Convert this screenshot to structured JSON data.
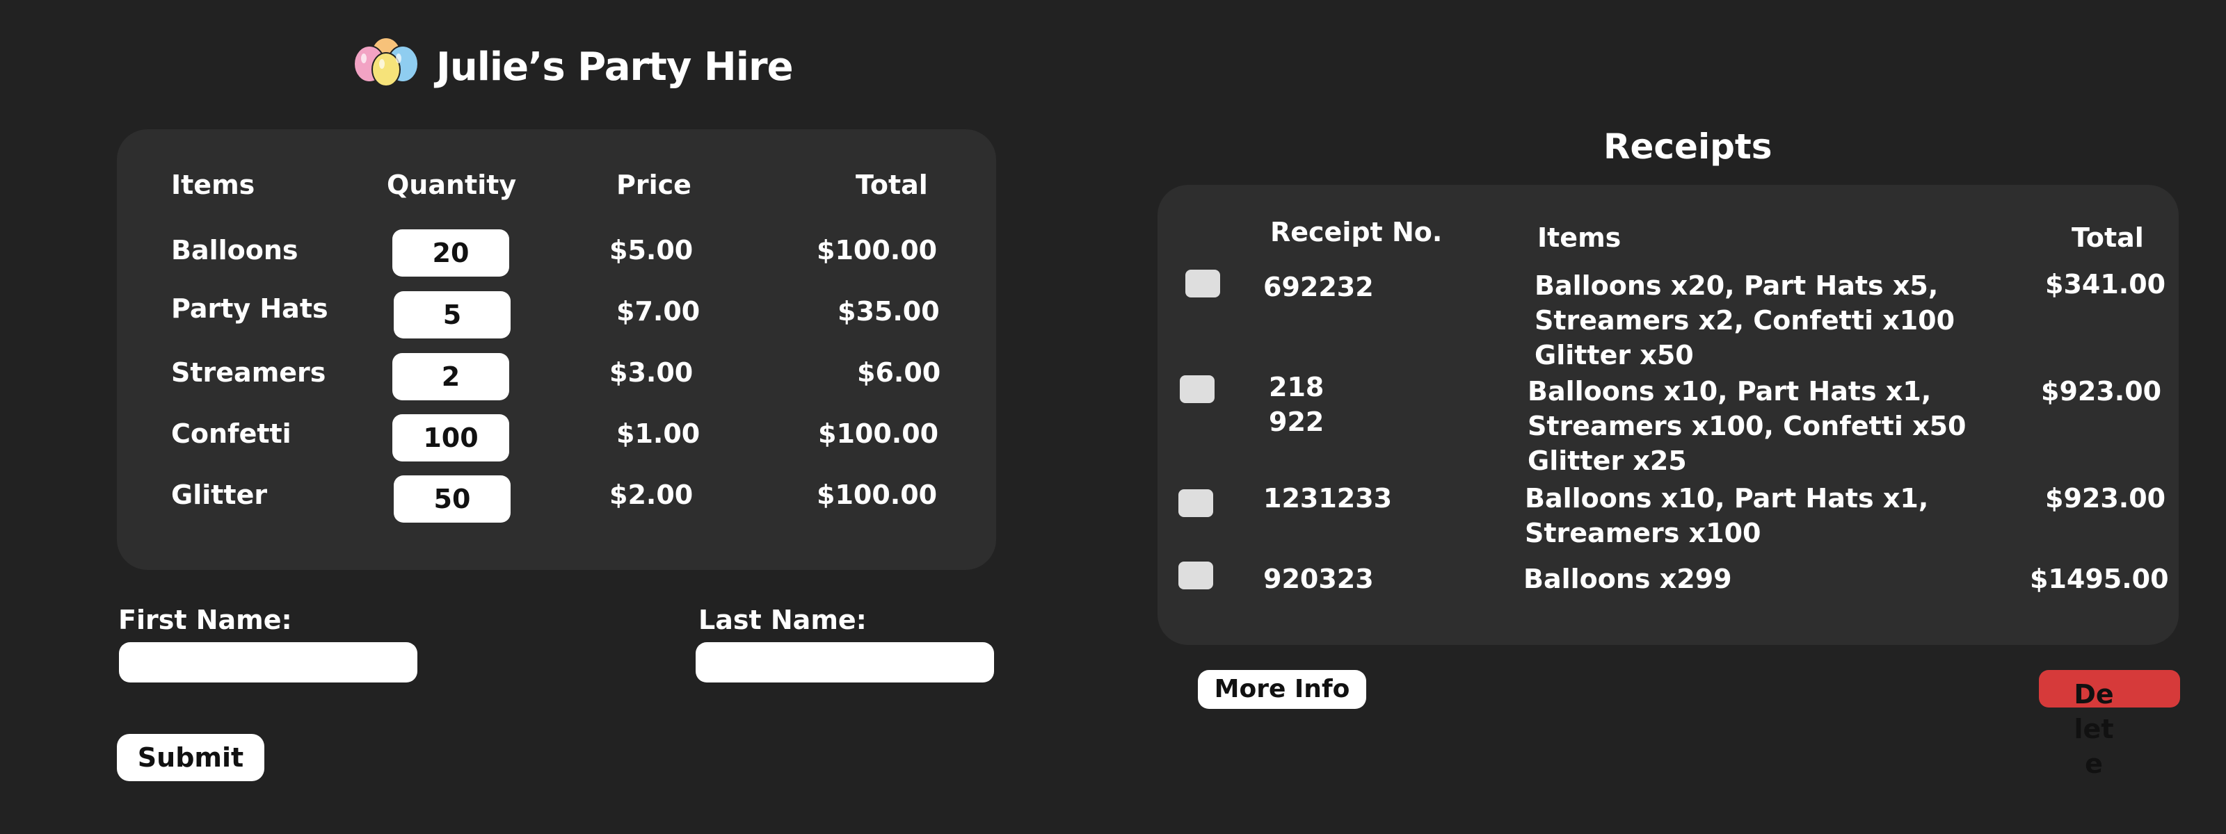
{
  "header": {
    "title": "Julie’s Party Hire",
    "logo_icon": "balloons-icon"
  },
  "order": {
    "headers": {
      "items": "Items",
      "quantity": "Quantity",
      "price": "Price",
      "total": "Total"
    },
    "rows": [
      {
        "item": "Balloons",
        "quantity": "20",
        "price": "$5.00",
        "total": "$100.00"
      },
      {
        "item": "Party Hats",
        "quantity": "5",
        "price": "$7.00",
        "total": "$35.00"
      },
      {
        "item": "Streamers",
        "quantity": "2",
        "price": "$3.00",
        "total": "$6.00"
      },
      {
        "item": "Confetti",
        "quantity": "100",
        "price": "$1.00",
        "total": "$100.00"
      },
      {
        "item": "Glitter",
        "quantity": "50",
        "price": "$2.00",
        "total": "$100.00"
      }
    ]
  },
  "form": {
    "first_name_label": "First Name:",
    "first_name_value": "",
    "last_name_label": "Last Name:",
    "last_name_value": "",
    "submit_label": "Submit"
  },
  "receipts": {
    "title": "Receipts",
    "headers": {
      "receipt_no": "Receipt No.",
      "items": "Items",
      "total": "Total"
    },
    "rows": [
      {
        "receipt_no": "692232",
        "items": "Balloons  x20, Part Hats x5,\nStreamers x2, Confetti x100\nGlitter x50",
        "total": "$341.00"
      },
      {
        "receipt_no": "218\n922",
        "items": "Balloons  x10, Part Hats x1,\nStreamers x100, Confetti x50\nGlitter x25",
        "total": "$923.00"
      },
      {
        "receipt_no": "1231233",
        "items": "Balloons  x10, Part Hats x1,\nStreamers x100",
        "total": "$923.00"
      },
      {
        "receipt_no": "920323",
        "items": "Balloons  x299",
        "total": "$1495.00"
      }
    ],
    "more_info_label": "More Info",
    "delete_label": "Delete"
  },
  "colors": {
    "background": "#222222",
    "card": "#2e2e2e",
    "delete": "#d63a3a"
  }
}
